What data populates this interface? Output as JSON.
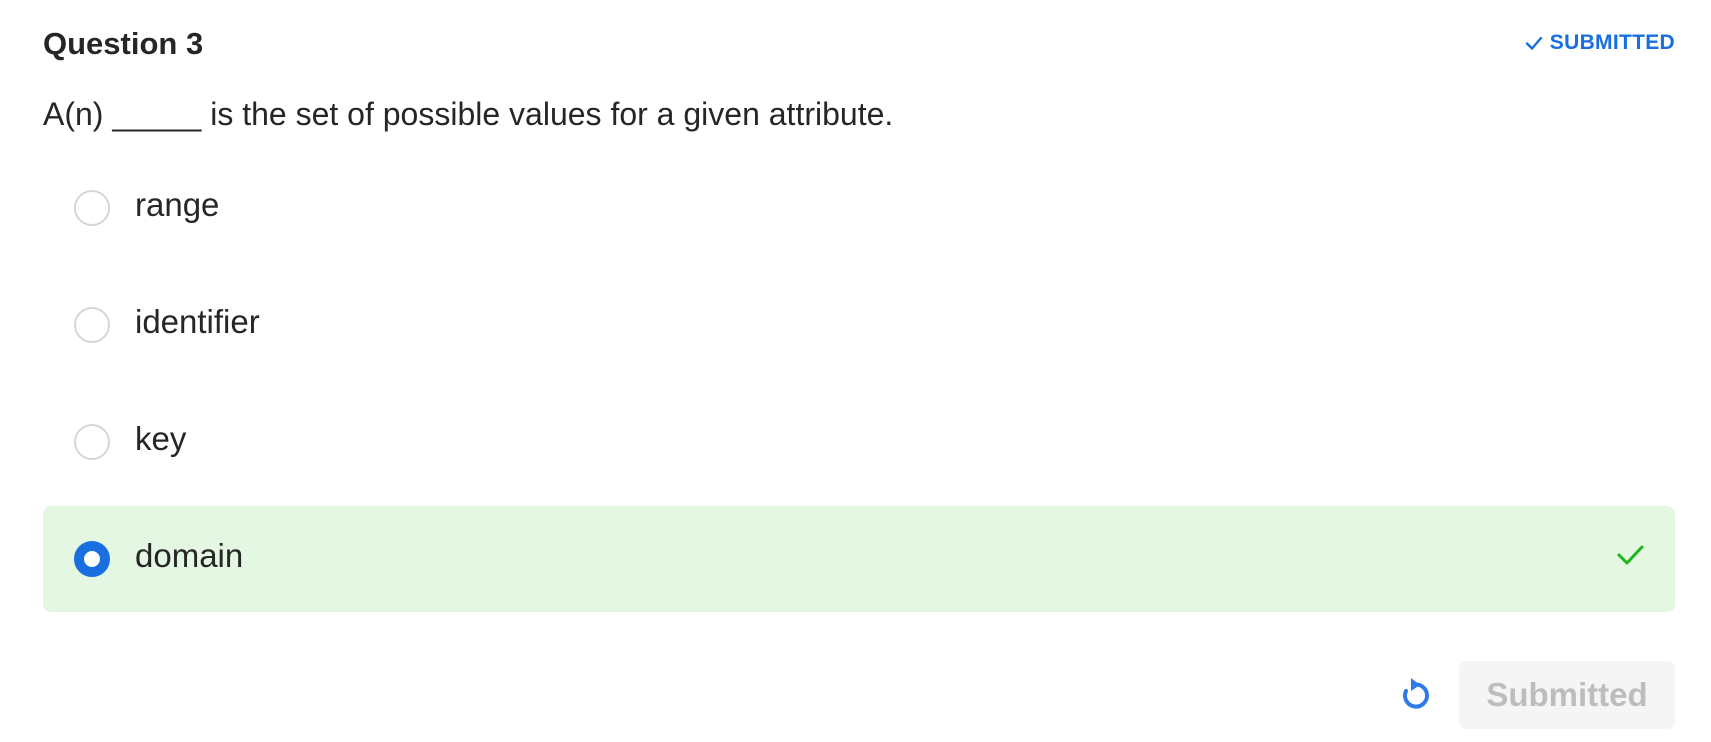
{
  "question": {
    "title": "Question 3",
    "status": "SUBMITTED",
    "prompt": "A(n) _____ is the set of possible values for a given attribute."
  },
  "options": [
    {
      "label": "range",
      "selected": false,
      "correct": false
    },
    {
      "label": "identifier",
      "selected": false,
      "correct": false
    },
    {
      "label": "key",
      "selected": false,
      "correct": false
    },
    {
      "label": "domain",
      "selected": true,
      "correct": true
    }
  ],
  "actions": {
    "reset_icon": "reset-icon",
    "submit_label": "Submitted"
  },
  "colors": {
    "accent": "#1a6fe0",
    "correct_bg": "#e4f7e3",
    "correct_check": "#1fb51f",
    "disabled_text": "#bdbdbd"
  }
}
